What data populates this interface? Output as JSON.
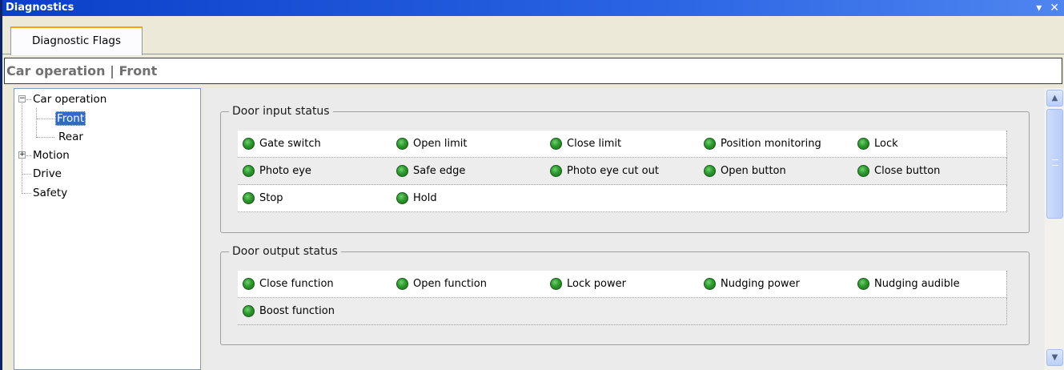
{
  "window": {
    "title": "Diagnostics",
    "menu_glyph": "▾",
    "close_glyph": "✕"
  },
  "tabs": [
    {
      "label": "Diagnostic Flags",
      "active": true
    }
  ],
  "breadcrumb": "Car operation | Front",
  "tree": {
    "nodes": [
      {
        "label": "Car operation",
        "expander": "−",
        "expanded": true
      },
      {
        "label": "Front",
        "selected": true
      },
      {
        "label": "Rear"
      },
      {
        "label": "Motion",
        "expander": "+",
        "expanded": false
      },
      {
        "label": "Drive"
      },
      {
        "label": "Safety"
      }
    ]
  },
  "groups": [
    {
      "title": "Door input status",
      "rows": [
        [
          "Gate switch",
          "Open limit",
          "Close limit",
          "Position monitoring",
          "Lock"
        ],
        [
          "Photo eye",
          "Safe edge",
          "Photo eye cut out",
          "Open button",
          "Close button"
        ],
        [
          "Stop",
          "Hold",
          "",
          "",
          ""
        ]
      ]
    },
    {
      "title": "Door output status",
      "rows": [
        [
          "Close function",
          "Open function",
          "Lock power",
          "Nudging power",
          "Nudging audible"
        ],
        [
          "Boost function",
          "",
          "",
          "",
          ""
        ]
      ]
    }
  ],
  "colors": {
    "led_on": "#2b9a2b",
    "titlebar": "#0a3fc8",
    "selection": "#316ac5",
    "tab_accent": "#f7a30b"
  }
}
